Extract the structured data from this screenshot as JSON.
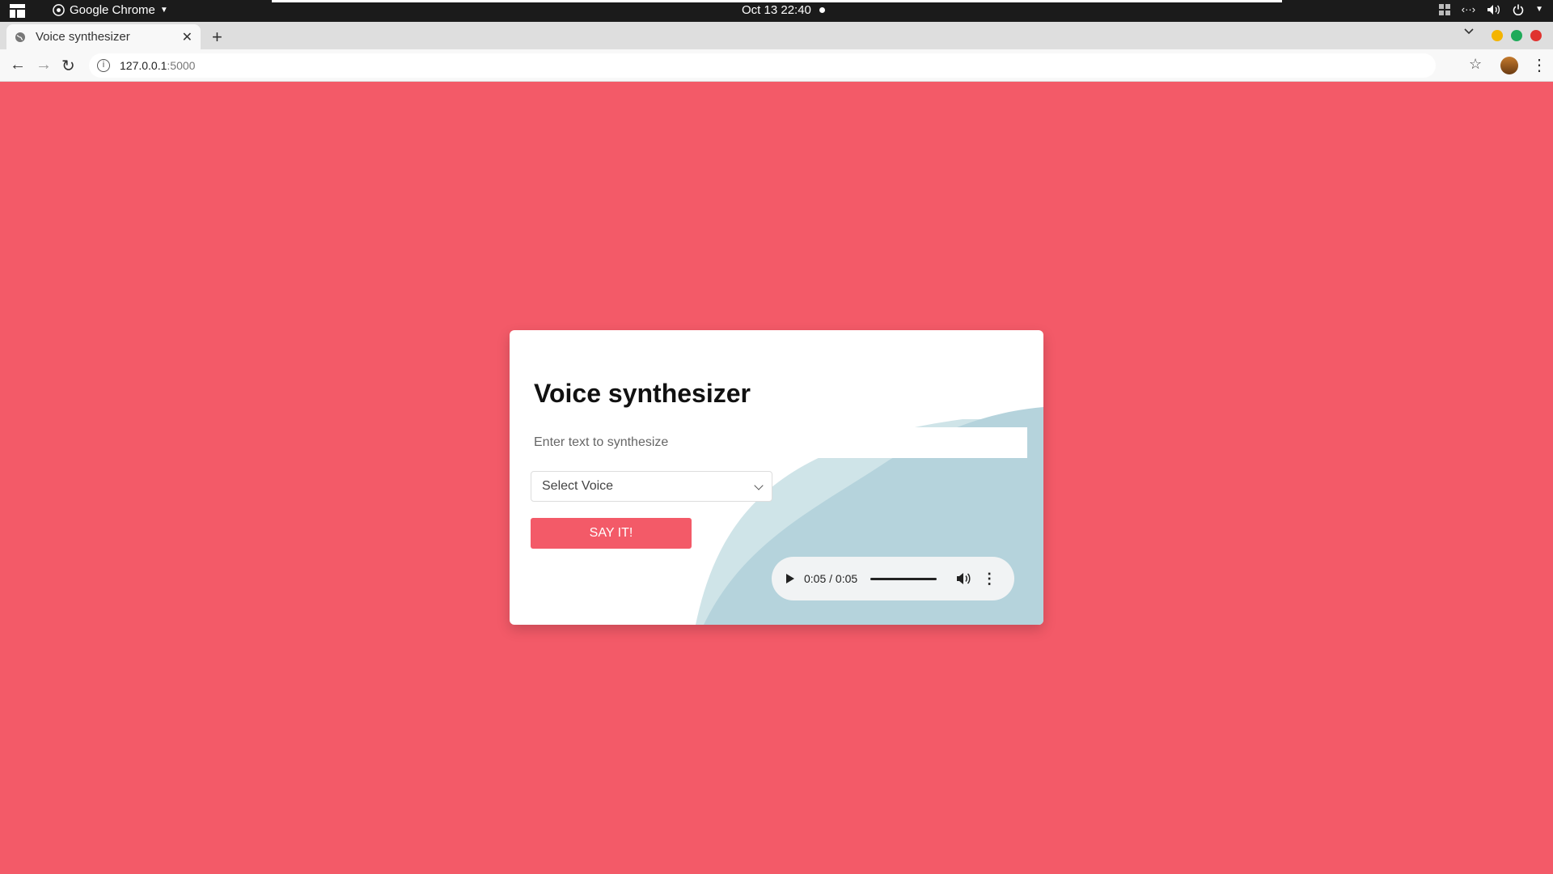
{
  "system": {
    "app_menu": "Google Chrome",
    "clock": "Oct 13  22:40"
  },
  "browser": {
    "tab_title": "Voice synthesizer",
    "url_host": "127.0.0.1",
    "url_port": ":5000"
  },
  "card": {
    "title": "Voice synthesizer",
    "text_placeholder": "Enter text to synthesize",
    "voice_select": "Select Voice",
    "say_button": "SAY IT!",
    "audio_time": "0:05 / 0:05",
    "audio_progress": 1.0
  },
  "colors": {
    "background": "#f35a68",
    "accent": "#f35a68",
    "wave_light": "#cfe4e8",
    "wave_dark": "#b5d3dc"
  }
}
